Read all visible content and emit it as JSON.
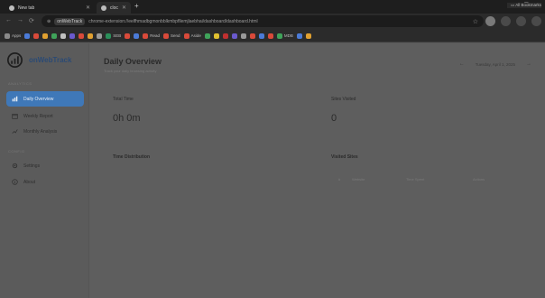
{
  "browser": {
    "tabs": [
      {
        "title": "New tab"
      },
      {
        "title": "cloc"
      }
    ],
    "address": {
      "chip": "onWebTrack",
      "url": "chrome-extension://eelfhmadbgmonbblkmbpfllemjlaebhai/dashboard/dashboard.html"
    },
    "bookmarks": [
      {
        "label": "Apps",
        "color": "#8a8a8a"
      },
      {
        "label": "",
        "color": "#4b7bd8"
      },
      {
        "label": "",
        "color": "#d94a3a"
      },
      {
        "label": "",
        "color": "#e0a030"
      },
      {
        "label": "",
        "color": "#3fa35a"
      },
      {
        "label": "",
        "color": "#c0c0c0"
      },
      {
        "label": "",
        "color": "#6a5acd"
      },
      {
        "label": "",
        "color": "#d94a3a"
      },
      {
        "label": "",
        "color": "#e0a030"
      },
      {
        "label": "",
        "color": "#9a9a9a"
      },
      {
        "label": "SEB",
        "color": "#2a8f5a"
      },
      {
        "label": "",
        "color": "#d94a3a"
      },
      {
        "label": "",
        "color": "#4b7bd8"
      },
      {
        "label": "Read",
        "color": "#d94a3a"
      },
      {
        "label": "Send",
        "color": "#d94a3a"
      },
      {
        "label": "Aside",
        "color": "#d94a3a"
      },
      {
        "label": "",
        "color": "#3fa35a"
      },
      {
        "label": "",
        "color": "#e0c030"
      },
      {
        "label": "",
        "color": "#c03030"
      },
      {
        "label": "",
        "color": "#6a5acd"
      },
      {
        "label": "",
        "color": "#9a9a9a"
      },
      {
        "label": "",
        "color": "#d94a3a"
      },
      {
        "label": "",
        "color": "#4b7bd8"
      },
      {
        "label": "",
        "color": "#d94a3a"
      },
      {
        "label": "MDB",
        "color": "#3fa35a"
      },
      {
        "label": "",
        "color": "#4b7bd8"
      },
      {
        "label": "",
        "color": "#e0a030"
      }
    ],
    "all_bookmarks": "All Bookmarks"
  },
  "app": {
    "brand": "onWebTrack",
    "sections": {
      "analytics": "ANALYTICS",
      "config": "CONFIG"
    },
    "nav": [
      {
        "label": "Daily Overview",
        "icon": "chart-icon",
        "active": true
      },
      {
        "label": "Weekly Report",
        "icon": "calendar-icon",
        "active": false
      },
      {
        "label": "Monthly Analysis",
        "icon": "trend-icon",
        "active": false
      },
      {
        "label": "Settings",
        "icon": "gear-icon",
        "active": false
      },
      {
        "label": "About",
        "icon": "info-icon",
        "active": false
      }
    ],
    "colors": {
      "accent": "#3f78b8",
      "brand": "#2b4a74"
    }
  },
  "main": {
    "title": "Daily Overview",
    "subtitle": "Track your daily browsing activity",
    "date": "Tuesday, April 1, 2025",
    "stats": {
      "total_time_label": "Total Time",
      "total_time_value": "0h 0m",
      "sites_visited_label": "Sites Visited",
      "sites_visited_value": "0"
    },
    "time_distribution_title": "Time Distribution",
    "visited_sites": {
      "title": "Visited Sites",
      "columns": [
        "#",
        "Website",
        "Time Spent",
        "Actions"
      ]
    }
  }
}
